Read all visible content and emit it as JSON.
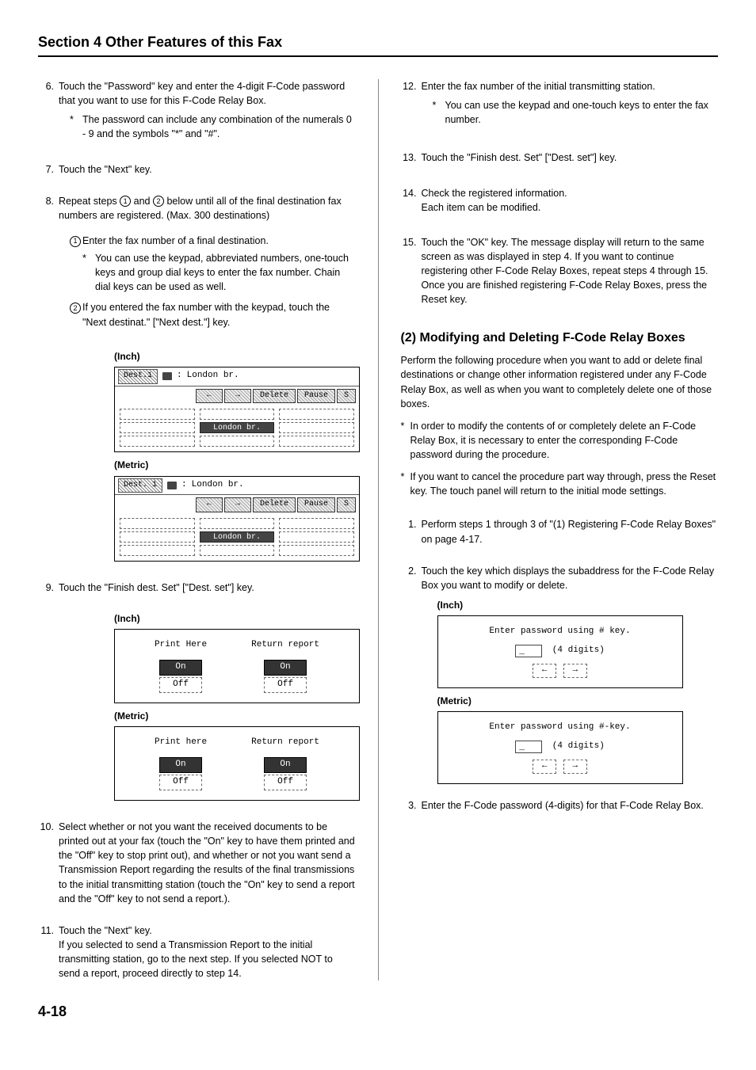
{
  "sectionTitle": "Section 4 Other Features of this Fax",
  "left": {
    "s6": {
      "n": "6.",
      "t": "Touch the \"Password\" key and enter the 4-digit F-Code password that you want to use for this F-Code Relay Box.",
      "sub_star": "*",
      "sub": "The password can include any combination of the numerals 0 - 9 and the symbols \"*\" and \"#\"."
    },
    "s7": {
      "n": "7.",
      "t": "Touch the \"Next\" key."
    },
    "s8": {
      "n": "8.",
      "t_a": "Repeat steps ",
      "t_b": " and ",
      "t_c": " below until all of the final destination fax numbers are registered. (Max. 300 destinations)",
      "c1": "1",
      "c2": "2",
      "sub1": {
        "c": "1",
        "t": "Enter the fax number of a final destination.",
        "star": "*",
        "star_t": "You can use the keypad, abbreviated numbers, one-touch keys and group dial keys to enter the fax number. Chain dial keys can be used as well."
      },
      "sub2": {
        "c": "2",
        "t": "If you entered the fax number with the keypad, touch the \"Next destinat.\" [\"Next dest.\"] key."
      }
    },
    "fig1": {
      "inchLabel": "(Inch)",
      "metricLabel": "(Metric)",
      "destInch": "Dest.1",
      "destMetric": "Dest. 1",
      "colon": ":",
      "place": "London br.",
      "arrL": "←",
      "arrR": "→",
      "del": "Delete",
      "pause": "Pause",
      "s": "S",
      "slotText": "London br."
    },
    "s9": {
      "n": "9.",
      "t": "Touch the \"Finish dest. Set\" [\"Dest. set\"] key."
    },
    "fig2": {
      "inchLabel": "(Inch)",
      "metricLabel": "(Metric)",
      "colA_inch": "Print Here",
      "colB_inch": "Return report",
      "colA_metric": "Print here",
      "colB_metric": "Return report",
      "on": "On",
      "off": "Off"
    },
    "s10": {
      "n": "10.",
      "t": "Select whether or not you want the received documents to be printed out at your fax (touch the \"On\" key to have them printed and the \"Off\" key to stop print out), and whether or not you want send a Transmission Report regarding the results of the final transmissions to the initial transmitting station (touch the \"On\" key to send a report and the \"Off\" key to not send a report.)."
    },
    "s11": {
      "n": "11.",
      "t": "Touch the \"Next\" key.",
      "t2": "If you selected to send a Transmission Report to the initial transmitting station, go to the next step. If you selected NOT to send a report, proceed directly to step 14."
    }
  },
  "right": {
    "s12": {
      "n": "12.",
      "t": "Enter the fax number of the initial transmitting station.",
      "star": "*",
      "star_t": "You can use the keypad and one-touch keys to enter the fax number."
    },
    "s13": {
      "n": "13.",
      "t": "Touch the \"Finish dest. Set\" [\"Dest. set\"] key."
    },
    "s14": {
      "n": "14.",
      "t": "Check the registered information.",
      "t2": "Each item can be modified."
    },
    "s15": {
      "n": "15.",
      "t": "Touch the \"OK\" key. The message display will return to the same screen as was displayed in step 4. If you want to continue registering other F-Code Relay Boxes, repeat steps 4 through 15. Once you are finished registering F-Code Relay Boxes, press the Reset key."
    },
    "h2": "(2) Modifying and Deleting F-Code Relay Boxes",
    "intro": "Perform the following procedure when you want to add or delete final destinations or change other information registered under any F-Code Relay Box, as well as when you want to completely delete one of those boxes.",
    "n1": {
      "star": "*",
      "t": "In order to modify the contents of or completely delete an F-Code Relay Box, it is necessary to enter the corresponding F-Code password during the procedure."
    },
    "n2": {
      "star": "*",
      "t": "If you want to cancel the procedure part way through, press the Reset key. The touch panel will return to the initial mode settings."
    },
    "r1": {
      "n": "1.",
      "t": "Perform steps 1 through 3 of \"(1) Registering F-Code Relay Boxes\" on page 4-17."
    },
    "r2": {
      "n": "2.",
      "t": "Touch the key which displays the subaddress for the F-Code Relay Box you want to modify or delete."
    },
    "pwfig": {
      "inchLabel": "(Inch)",
      "metricLabel": "(Metric)",
      "inchPrompt": "Enter password using # key.",
      "metricPrompt": "Enter password using #-key.",
      "cursor": "_",
      "digits": "(4 digits)",
      "arrL": "←",
      "arrR": "→"
    },
    "r3": {
      "n": "3.",
      "t": "Enter the F-Code password (4-digits) for that F-Code Relay Box."
    }
  },
  "pageNum": "4-18"
}
